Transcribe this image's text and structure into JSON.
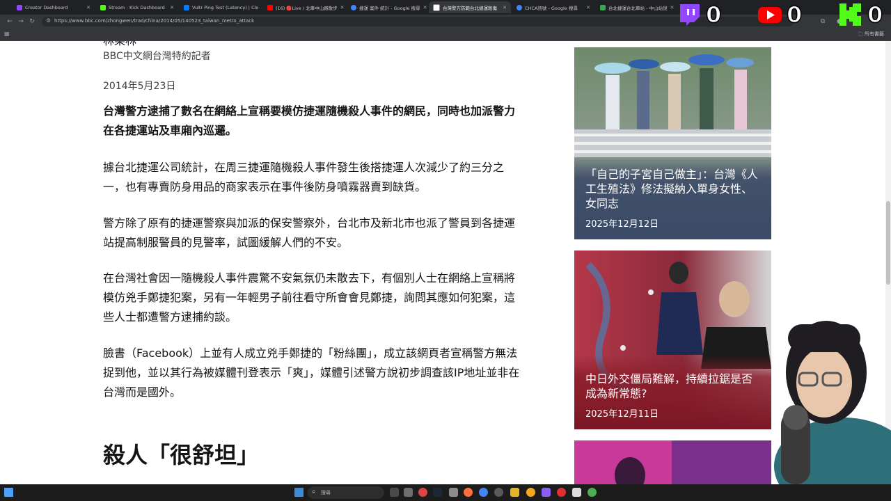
{
  "browser": {
    "tabs": [
      {
        "label": "Creator Dashboard",
        "favicon_color": "#9146ff"
      },
      {
        "label": "Stream - Kick Dashboard",
        "favicon_color": "#53fc18"
      },
      {
        "label": "Vultr Ping Test (Latency) | Clo",
        "favicon_color": "#007bfc"
      },
      {
        "label": "(16) 🔴Live / 北車中山路散步",
        "favicon_color": "#ff0000"
      },
      {
        "label": "捷運 案件 統計 - Google 搜尋",
        "favicon_color": "#4285f4"
      },
      {
        "label": "台灣警方防範台北捷運殺傷",
        "favicon_color": "#ffffff"
      },
      {
        "label": "CHCA訊號 - Google 搜尋",
        "favicon_color": "#4285f4"
      },
      {
        "label": "台北捷運台北車站 - 中山站說",
        "favicon_color": "#34a853"
      }
    ],
    "url": "https://www.bbc.com/zhongwen/trad/china/2014/05/140523_taiwan_metro_attack",
    "bookmarks_all": "所有書籤"
  },
  "overlay": {
    "twitch_count": "0",
    "youtube_count": "0",
    "kick_count": "0"
  },
  "article": {
    "author_name": "林樂林",
    "author_role": "BBC中文網台灣特約記者",
    "date": "2014年5月23日",
    "lead": "台灣警方逮捕了數名在網絡上宣稱要模仿捷運隨機殺人事件的網民，同時也加派警力在各捷運站及車廂內巡邏。",
    "paragraphs": [
      "據台北捷運公司統計，在周三捷運隨機殺人事件發生後搭捷運人次減少了約三分之一，也有專賣防身用品的商家表示在事件後防身噴霧器賣到缺貨。",
      "警方除了原有的捷運警察與加派的保安警察外，台北市及新北市也派了警員到各捷運站提高制服警員的見警率，試圖緩解人們的不安。",
      "在台灣社會因一隨機殺人事件震驚不安氣氛仍未散去下，有個別人士在網絡上宣稱將模仿兇手鄭捷犯案，另有一年輕男子前往看守所會會見鄭捷，詢問其應如何犯案，這些人士都遭警方逮捕約談。",
      "臉書（Facebook）上並有人成立兇手鄭捷的「粉絲團」，成立該網頁者宣稱警方無法捉到他，並以其行為被媒體刊登表示「爽」，媒體引述警方說初步調查該IP地址並非在台灣而是國外。"
    ],
    "subheading": "殺人「很舒坦」"
  },
  "sidebar": {
    "cards": [
      {
        "title": "「自己的子宮自己做主」：台灣《人工生殖法》修法擬納入單身女性、女同志",
        "date": "2025年12月12日"
      },
      {
        "title": "中日外交僵局難解，持續拉鋸是否成為新常態?",
        "date": "2025年12月11日"
      }
    ]
  },
  "taskbar": {
    "search_placeholder": "搜尋"
  },
  "colors": {
    "card1_overlay": "#3b4a66",
    "card2_overlay": "#8a1d2a",
    "twitch": "#9146ff",
    "youtube": "#ff0000",
    "kick": "#53fc18"
  }
}
